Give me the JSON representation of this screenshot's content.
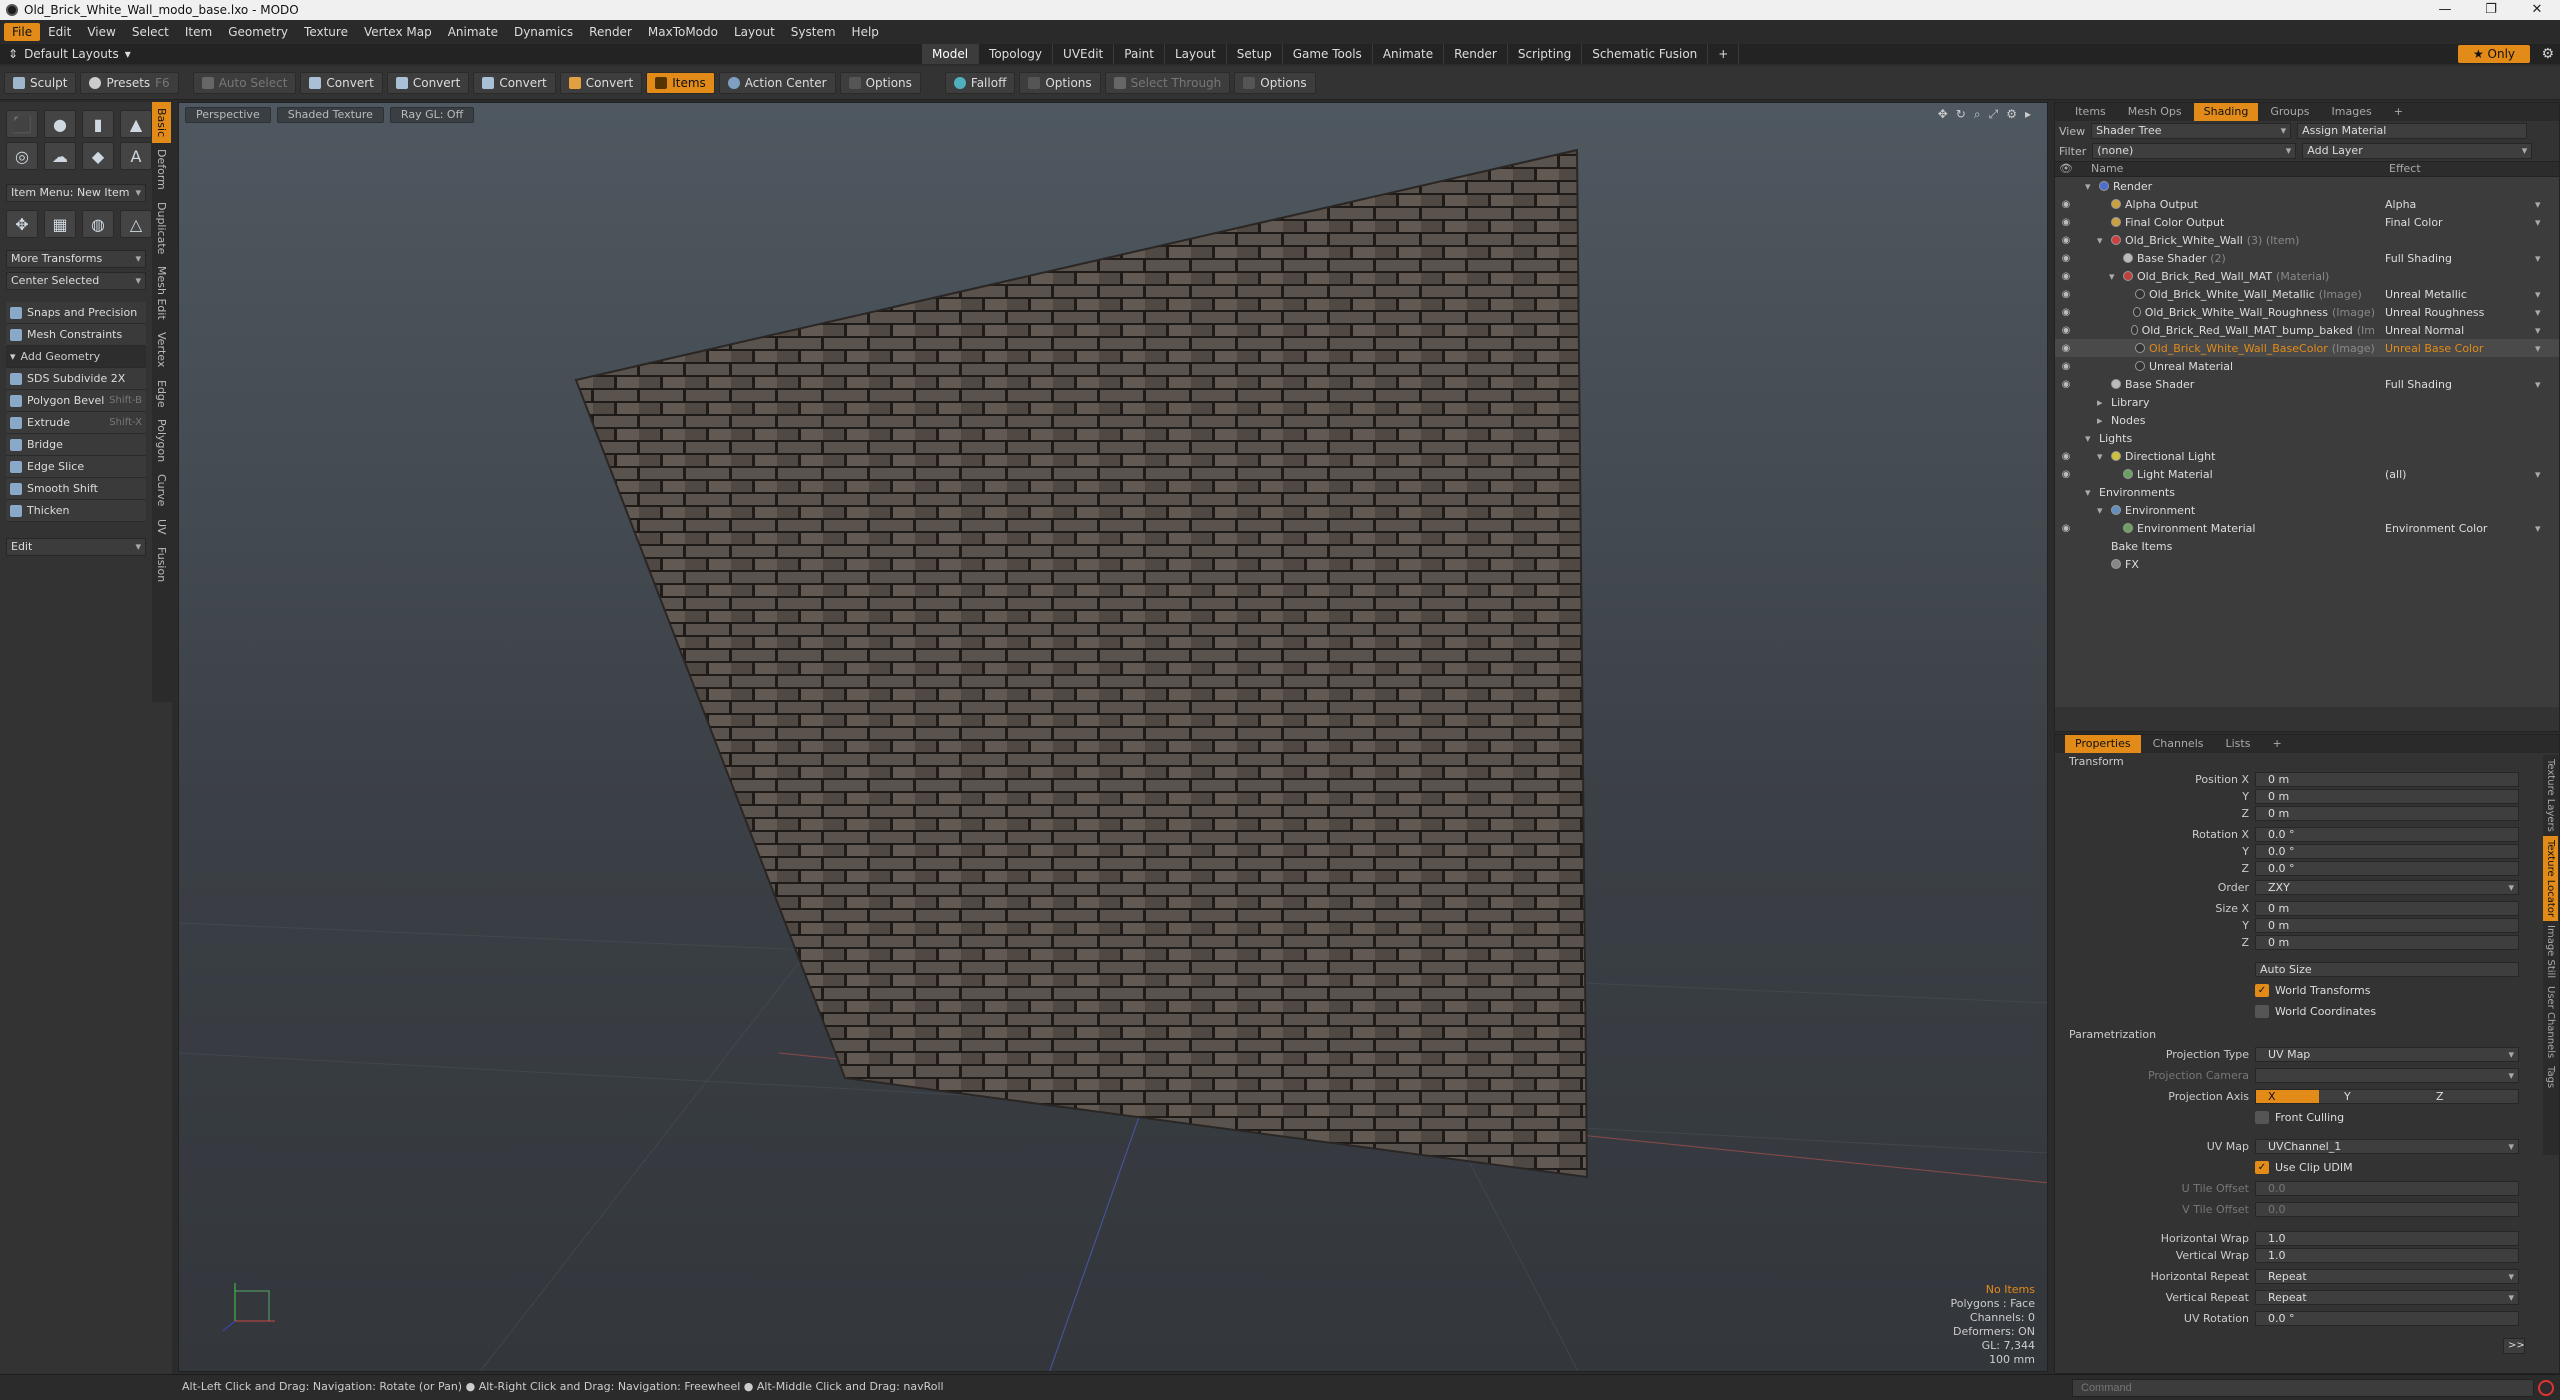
{
  "window": {
    "title": "Old_Brick_White_Wall_modo_base.lxo - MODO",
    "controls": [
      "—",
      "❐",
      "✕"
    ]
  },
  "menu": [
    "File",
    "Edit",
    "View",
    "Select",
    "Item",
    "Geometry",
    "Texture",
    "Vertex Map",
    "Animate",
    "Dynamics",
    "Render",
    "MaxToModo",
    "Layout",
    "System",
    "Help"
  ],
  "layouts": {
    "selector": "Default Layouts",
    "tabs": [
      "Model",
      "Topology",
      "UVEdit",
      "Paint",
      "Layout",
      "Setup",
      "Game Tools",
      "Animate",
      "Render",
      "Scripting",
      "Schematic Fusion",
      "+"
    ],
    "active_tab": "Model",
    "only_label": "★ Only"
  },
  "toolbar": {
    "sculpt": "Sculpt",
    "presets": "Presets",
    "presets_key": "F6",
    "auto_select": "Auto Select",
    "convert1": "Convert",
    "convert2": "Convert",
    "convert3": "Convert",
    "convert4": "Convert",
    "items": "Items",
    "action_center": "Action Center",
    "options1": "Options",
    "falloff": "Falloff",
    "options2": "Options",
    "select_through": "Select Through",
    "options3": "Options"
  },
  "left": {
    "item_menu": "Item Menu: New Item",
    "more_transforms": "More Transforms",
    "center_selected": "Center Selected",
    "side_tabs": [
      "Basic",
      "Deform",
      "Duplicate",
      "Mesh Edit",
      "Vertex",
      "Edge",
      "Polygon",
      "Curve",
      "UV",
      "Fusion"
    ],
    "tools": [
      {
        "label": "Snaps and Precision",
        "hotkey": ""
      },
      {
        "label": "Mesh Constraints",
        "hotkey": ""
      },
      {
        "label": "Add Geometry",
        "hotkey": "",
        "header": true
      },
      {
        "label": "SDS Subdivide 2X",
        "hotkey": ""
      },
      {
        "label": "Polygon Bevel",
        "hotkey": "Shift-B"
      },
      {
        "label": "Extrude",
        "hotkey": "Shift-X"
      },
      {
        "label": "Bridge",
        "hotkey": ""
      },
      {
        "label": "Edge Slice",
        "hotkey": ""
      },
      {
        "label": "Smooth Shift",
        "hotkey": ""
      },
      {
        "label": "Thicken",
        "hotkey": ""
      }
    ],
    "edit_dropdown": "Edit"
  },
  "viewport": {
    "tabs": [
      "Perspective",
      "Shaded Texture",
      "Ray GL: Off"
    ],
    "info": {
      "no_items": "No Items",
      "polygons": "Polygons : Face",
      "channels": "Channels: 0",
      "deformers": "Deformers: ON",
      "gl": "GL: 7,344",
      "scale": "100 mm"
    }
  },
  "shading": {
    "tabs": [
      "Items",
      "Mesh Ops",
      "Shading",
      "Groups",
      "Images",
      "+"
    ],
    "active_tab": "Shading",
    "view_label": "View",
    "view_value": "Shader Tree",
    "assign_material": "Assign Material",
    "filter_label": "Filter",
    "filter_value": "(none)",
    "add_layer": "Add Layer",
    "col_name": "Name",
    "col_effect": "Effect",
    "rows": [
      {
        "indent": 0,
        "name": "Render",
        "sub": "",
        "effect": "",
        "icon": "#4a6fd0",
        "eye": false,
        "arrow": "▾"
      },
      {
        "indent": 1,
        "name": "Alpha Output",
        "sub": "",
        "effect": "Alpha",
        "icon": "#caa040",
        "eye": true,
        "arrow": ""
      },
      {
        "indent": 1,
        "name": "Final Color Output",
        "sub": "",
        "effect": "Final Color",
        "icon": "#caa040",
        "eye": true,
        "arrow": ""
      },
      {
        "indent": 1,
        "name": "Old_Brick_White_Wall",
        "sub": "(3) (Item)",
        "effect": "",
        "icon": "#d04040",
        "eye": true,
        "arrow": "▾"
      },
      {
        "indent": 2,
        "name": "Base Shader",
        "sub": "(2)",
        "effect": "Full Shading",
        "icon": "#bbbbbb",
        "eye": true,
        "arrow": ""
      },
      {
        "indent": 2,
        "name": "Old_Brick_Red_Wall_MAT",
        "sub": "(Material)",
        "effect": "",
        "icon": "#c04040",
        "eye": true,
        "arrow": "▾"
      },
      {
        "indent": 3,
        "name": "Old_Brick_White_Wall_Metallic",
        "sub": "(Image)",
        "effect": "Unreal Metallic",
        "icon": "#333333",
        "eye": true,
        "arrow": ""
      },
      {
        "indent": 3,
        "name": "Old_Brick_White_Wall_Roughness",
        "sub": "(Image)",
        "effect": "Unreal Roughness",
        "icon": "#333333",
        "eye": true,
        "arrow": ""
      },
      {
        "indent": 3,
        "name": "Old_Brick_Red_Wall_MAT_bump_baked",
        "sub": "(Im",
        "effect": "Unreal Normal",
        "icon": "#333333",
        "eye": true,
        "arrow": ""
      },
      {
        "indent": 3,
        "name": "Old_Brick_White_Wall_BaseColor",
        "sub": "(Image)",
        "effect": "Unreal Base Color",
        "icon": "#333333",
        "eye": true,
        "arrow": "",
        "selected": true
      },
      {
        "indent": 3,
        "name": "Unreal Material",
        "sub": "",
        "effect": "",
        "icon": "#333333",
        "eye": true,
        "arrow": ""
      },
      {
        "indent": 1,
        "name": "Base Shader",
        "sub": "",
        "effect": "Full Shading",
        "icon": "#bbbbbb",
        "eye": true,
        "arrow": ""
      },
      {
        "indent": 1,
        "name": "Library",
        "sub": "",
        "effect": "",
        "icon": "",
        "eye": false,
        "arrow": "▸"
      },
      {
        "indent": 1,
        "name": "Nodes",
        "sub": "",
        "effect": "",
        "icon": "",
        "eye": false,
        "arrow": "▸"
      },
      {
        "indent": 0,
        "name": "Lights",
        "sub": "",
        "effect": "",
        "icon": "",
        "eye": false,
        "arrow": "▾"
      },
      {
        "indent": 1,
        "name": "Directional Light",
        "sub": "",
        "effect": "",
        "icon": "#d0c040",
        "eye": true,
        "arrow": "▾"
      },
      {
        "indent": 2,
        "name": "Light Material",
        "sub": "",
        "effect": "(all)",
        "icon": "#6aa060",
        "eye": true,
        "arrow": ""
      },
      {
        "indent": 0,
        "name": "Environments",
        "sub": "",
        "effect": "",
        "icon": "",
        "eye": false,
        "arrow": "▾"
      },
      {
        "indent": 1,
        "name": "Environment",
        "sub": "",
        "effect": "",
        "icon": "#6090c0",
        "eye": false,
        "arrow": "▾"
      },
      {
        "indent": 2,
        "name": "Environment Material",
        "sub": "",
        "effect": "Environment Color",
        "icon": "#6aa060",
        "eye": true,
        "arrow": ""
      },
      {
        "indent": 1,
        "name": "Bake Items",
        "sub": "",
        "effect": "",
        "icon": "",
        "eye": false,
        "arrow": ""
      },
      {
        "indent": 1,
        "name": "FX",
        "sub": "",
        "effect": "",
        "icon": "#888888",
        "eye": false,
        "arrow": ""
      }
    ]
  },
  "properties": {
    "tabs": [
      "Properties",
      "Channels",
      "Lists",
      "+"
    ],
    "active_tab": "Properties",
    "side_tabs": [
      "Texture Layers",
      "Texture Locator",
      "Image Still",
      "User Channels",
      "Tags"
    ],
    "transform_title": "Transform",
    "position_x": "0 m",
    "position_y": "0 m",
    "position_z": "0 m",
    "rotation_x": "0.0 °",
    "rotation_y": "0.0 °",
    "rotation_z": "0.0 °",
    "order": "ZXY",
    "size_x": "0 m",
    "size_y": "0 m",
    "size_z": "0 m",
    "labels": {
      "position_x": "Position X",
      "y": "Y",
      "z": "Z",
      "rotation_x": "Rotation X",
      "order": "Order",
      "size_x": "Size X"
    },
    "auto_size": "Auto Size",
    "world_transforms": "World Transforms",
    "world_coordinates": "World Coordinates",
    "param_title": "Parametrization",
    "projection_type_label": "Projection Type",
    "projection_type": "UV Map",
    "projection_camera_label": "Projection Camera",
    "projection_camera": "",
    "projection_axis_label": "Projection Axis",
    "axis_x": "X",
    "axis_y": "Y",
    "axis_z": "Z",
    "front_culling": "Front Culling",
    "uv_map_label": "UV Map",
    "uv_map": "UVChannel_1",
    "use_clip_udim": "Use Clip UDIM",
    "u_tile_label": "U Tile Offset",
    "u_tile": "0.0",
    "v_tile_label": "V Tile Offset",
    "v_tile": "0.0",
    "h_wrap_label": "Horizontal Wrap",
    "h_wrap": "1.0",
    "v_wrap_label": "Vertical Wrap",
    "v_wrap": "1.0",
    "h_repeat_label": "Horizontal Repeat",
    "h_repeat": "Repeat",
    "v_repeat_label": "Vertical Repeat",
    "v_repeat": "Repeat",
    "uv_rot_label": "UV Rotation",
    "uv_rot": "0.0 °",
    "more": ">>"
  },
  "status": {
    "hint": "Alt-Left Click and Drag: Navigation: Rotate (or Pan) ● Alt-Right Click and Drag: Navigation: Freewheel ● Alt-Middle Click and Drag: navRoll",
    "command_placeholder": "Command"
  }
}
